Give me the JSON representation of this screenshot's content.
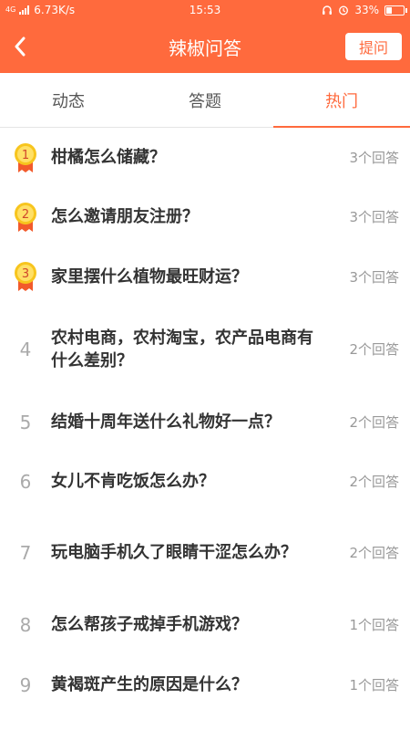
{
  "status_bar": {
    "network": "4G",
    "speed": "6.73K/s",
    "time": "15:53",
    "battery": "33%",
    "battery_level": 0.33
  },
  "nav": {
    "back_icon": "back-arrow-icon",
    "title": "辣椒问答",
    "ask_label": "提问"
  },
  "tabs": [
    {
      "label": "动态",
      "active": false
    },
    {
      "label": "答题",
      "active": false
    },
    {
      "label": "热门",
      "active": true
    }
  ],
  "questions": [
    {
      "rank": "1",
      "medal": true,
      "title": "柑橘怎么储藏？",
      "answers": "3个回答"
    },
    {
      "rank": "2",
      "medal": true,
      "title": "怎么邀请朋友注册？",
      "answers": "3个回答"
    },
    {
      "rank": "3",
      "medal": true,
      "title": "家里摆什么植物最旺财运？",
      "answers": "3个回答"
    },
    {
      "rank": "4",
      "medal": false,
      "title": "农村电商，农村淘宝，农产品电商有什么差别？",
      "answers": "2个回答"
    },
    {
      "rank": "5",
      "medal": false,
      "title": "结婚十周年送什么礼物好一点？",
      "answers": "2个回答"
    },
    {
      "rank": "6",
      "medal": false,
      "title": "女儿不肯吃饭怎么办？",
      "answers": "2个回答"
    },
    {
      "rank": "7",
      "medal": false,
      "title": "玩电脑手机久了眼睛干涩怎么办？",
      "answers": "2个回答"
    },
    {
      "rank": "8",
      "medal": false,
      "title": "怎么帮孩子戒掉手机游戏？",
      "answers": "1个回答"
    },
    {
      "rank": "9",
      "medal": false,
      "title": "黄褐斑产生的原因是什么？",
      "answers": "1个回答"
    }
  ],
  "colors": {
    "accent": "#ff6a3d",
    "medal_gold": "#f7c51e",
    "medal_ribbon": "#f25a2b"
  }
}
